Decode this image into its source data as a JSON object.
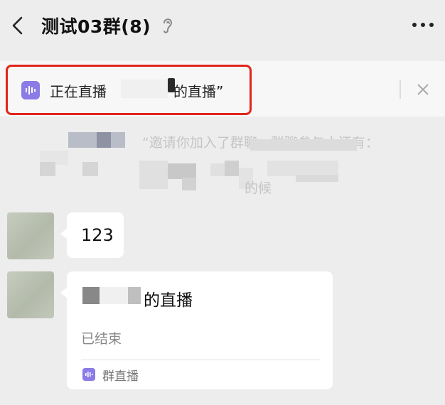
{
  "header": {
    "title": "测试03群(8)"
  },
  "banner": {
    "text_prefix": "正在直播",
    "text_suffix": "的直播”"
  },
  "system_message": {
    "line1": "“邀请你加入了群聊，群聊参与人还有：",
    "line2": "的候"
  },
  "messages": [
    {
      "type": "text",
      "text": "123"
    },
    {
      "type": "live_card",
      "title_suffix": "的直播",
      "status": "已结束",
      "footer_label": "群直播"
    }
  ],
  "colors": {
    "background": "#ededed",
    "highlight_border": "#e1251b",
    "live_icon": "#8a7be6"
  }
}
